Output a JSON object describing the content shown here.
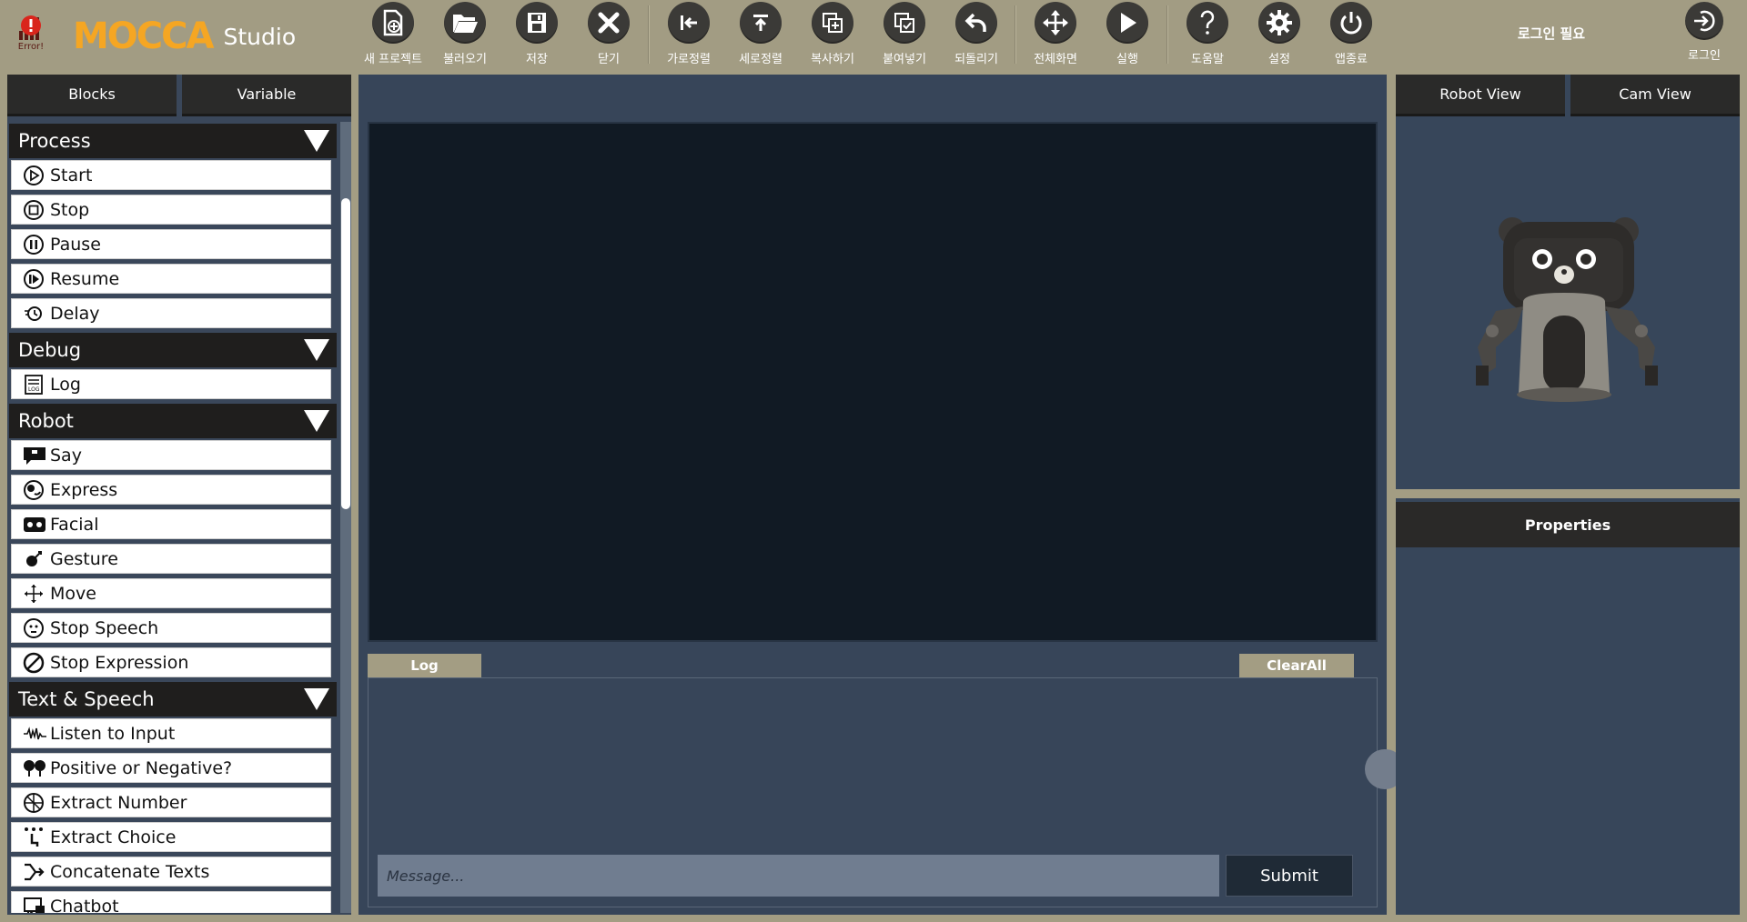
{
  "app": {
    "error_label": "Error!",
    "logo_text": "MOCCA",
    "logo_suffix": "Studio",
    "login_needed": "로그인 필요",
    "login_label": "로그인"
  },
  "toolbar": [
    {
      "id": "new-project",
      "label": "새 프로젝트",
      "icon": "new-file-icon"
    },
    {
      "id": "open",
      "label": "불러오기",
      "icon": "folder-open-icon"
    },
    {
      "id": "save",
      "label": "저장",
      "icon": "floppy-disk-icon"
    },
    {
      "id": "close",
      "label": "닫기",
      "icon": "close-icon"
    },
    {
      "id": "align-horizontal",
      "label": "가로정렬",
      "icon": "align-left-icon"
    },
    {
      "id": "align-vertical",
      "label": "세로정렬",
      "icon": "align-top-icon"
    },
    {
      "id": "copy",
      "label": "복사하기",
      "icon": "copy-icon"
    },
    {
      "id": "paste",
      "label": "붙여넣기",
      "icon": "paste-icon"
    },
    {
      "id": "undo",
      "label": "되돌리기",
      "icon": "undo-icon"
    },
    {
      "id": "fullscreen",
      "label": "전체화면",
      "icon": "fullscreen-icon"
    },
    {
      "id": "run",
      "label": "실행",
      "icon": "play-icon"
    },
    {
      "id": "help",
      "label": "도움말",
      "icon": "help-icon"
    },
    {
      "id": "settings",
      "label": "설정",
      "icon": "gear-icon"
    },
    {
      "id": "quit",
      "label": "앱종료",
      "icon": "power-icon"
    }
  ],
  "left": {
    "tabs": [
      "Blocks",
      "Variable"
    ],
    "categories": [
      {
        "title": "Process",
        "items": [
          {
            "label": "Start",
            "icon": "play-circle-icon"
          },
          {
            "label": "Stop",
            "icon": "stop-circle-icon"
          },
          {
            "label": "Pause",
            "icon": "pause-circle-icon"
          },
          {
            "label": "Resume",
            "icon": "resume-circle-icon"
          },
          {
            "label": "Delay",
            "icon": "delay-icon"
          }
        ]
      },
      {
        "title": "Debug",
        "items": [
          {
            "label": "Log",
            "icon": "log-icon"
          }
        ]
      },
      {
        "title": "Robot",
        "items": [
          {
            "label": "Say",
            "icon": "speech-bubble-icon"
          },
          {
            "label": "Express",
            "icon": "express-icon"
          },
          {
            "label": "Facial",
            "icon": "face-display-icon"
          },
          {
            "label": "Gesture",
            "icon": "gesture-icon"
          },
          {
            "label": "Move",
            "icon": "move-arrows-icon"
          },
          {
            "label": "Stop Speech",
            "icon": "stop-speech-icon"
          },
          {
            "label": "Stop Expression",
            "icon": "prohibited-icon"
          }
        ]
      },
      {
        "title": "Text & Speech",
        "items": [
          {
            "label": "Listen to Input",
            "icon": "waveform-icon"
          },
          {
            "label": "Positive or Negative?",
            "icon": "sentiment-icon"
          },
          {
            "label": "Extract Number",
            "icon": "extract-number-icon"
          },
          {
            "label": "Extract Choice",
            "icon": "choice-icon"
          },
          {
            "label": "Concatenate Texts",
            "icon": "concatenate-icon"
          },
          {
            "label": "Chatbot",
            "icon": "chatbot-icon"
          }
        ]
      }
    ]
  },
  "center": {
    "log_tab": "Log",
    "clear_all": "ClearAll",
    "message_placeholder": "Message...",
    "submit": "Submit"
  },
  "right": {
    "tabs": [
      "Robot View",
      "Cam View"
    ],
    "properties_title": "Properties"
  },
  "colors": {
    "chrome": "#a39d83",
    "panel": "#374559",
    "canvas": "#111a24",
    "dark_button": "#2a2a29",
    "logo_orange": "#f5a623"
  }
}
